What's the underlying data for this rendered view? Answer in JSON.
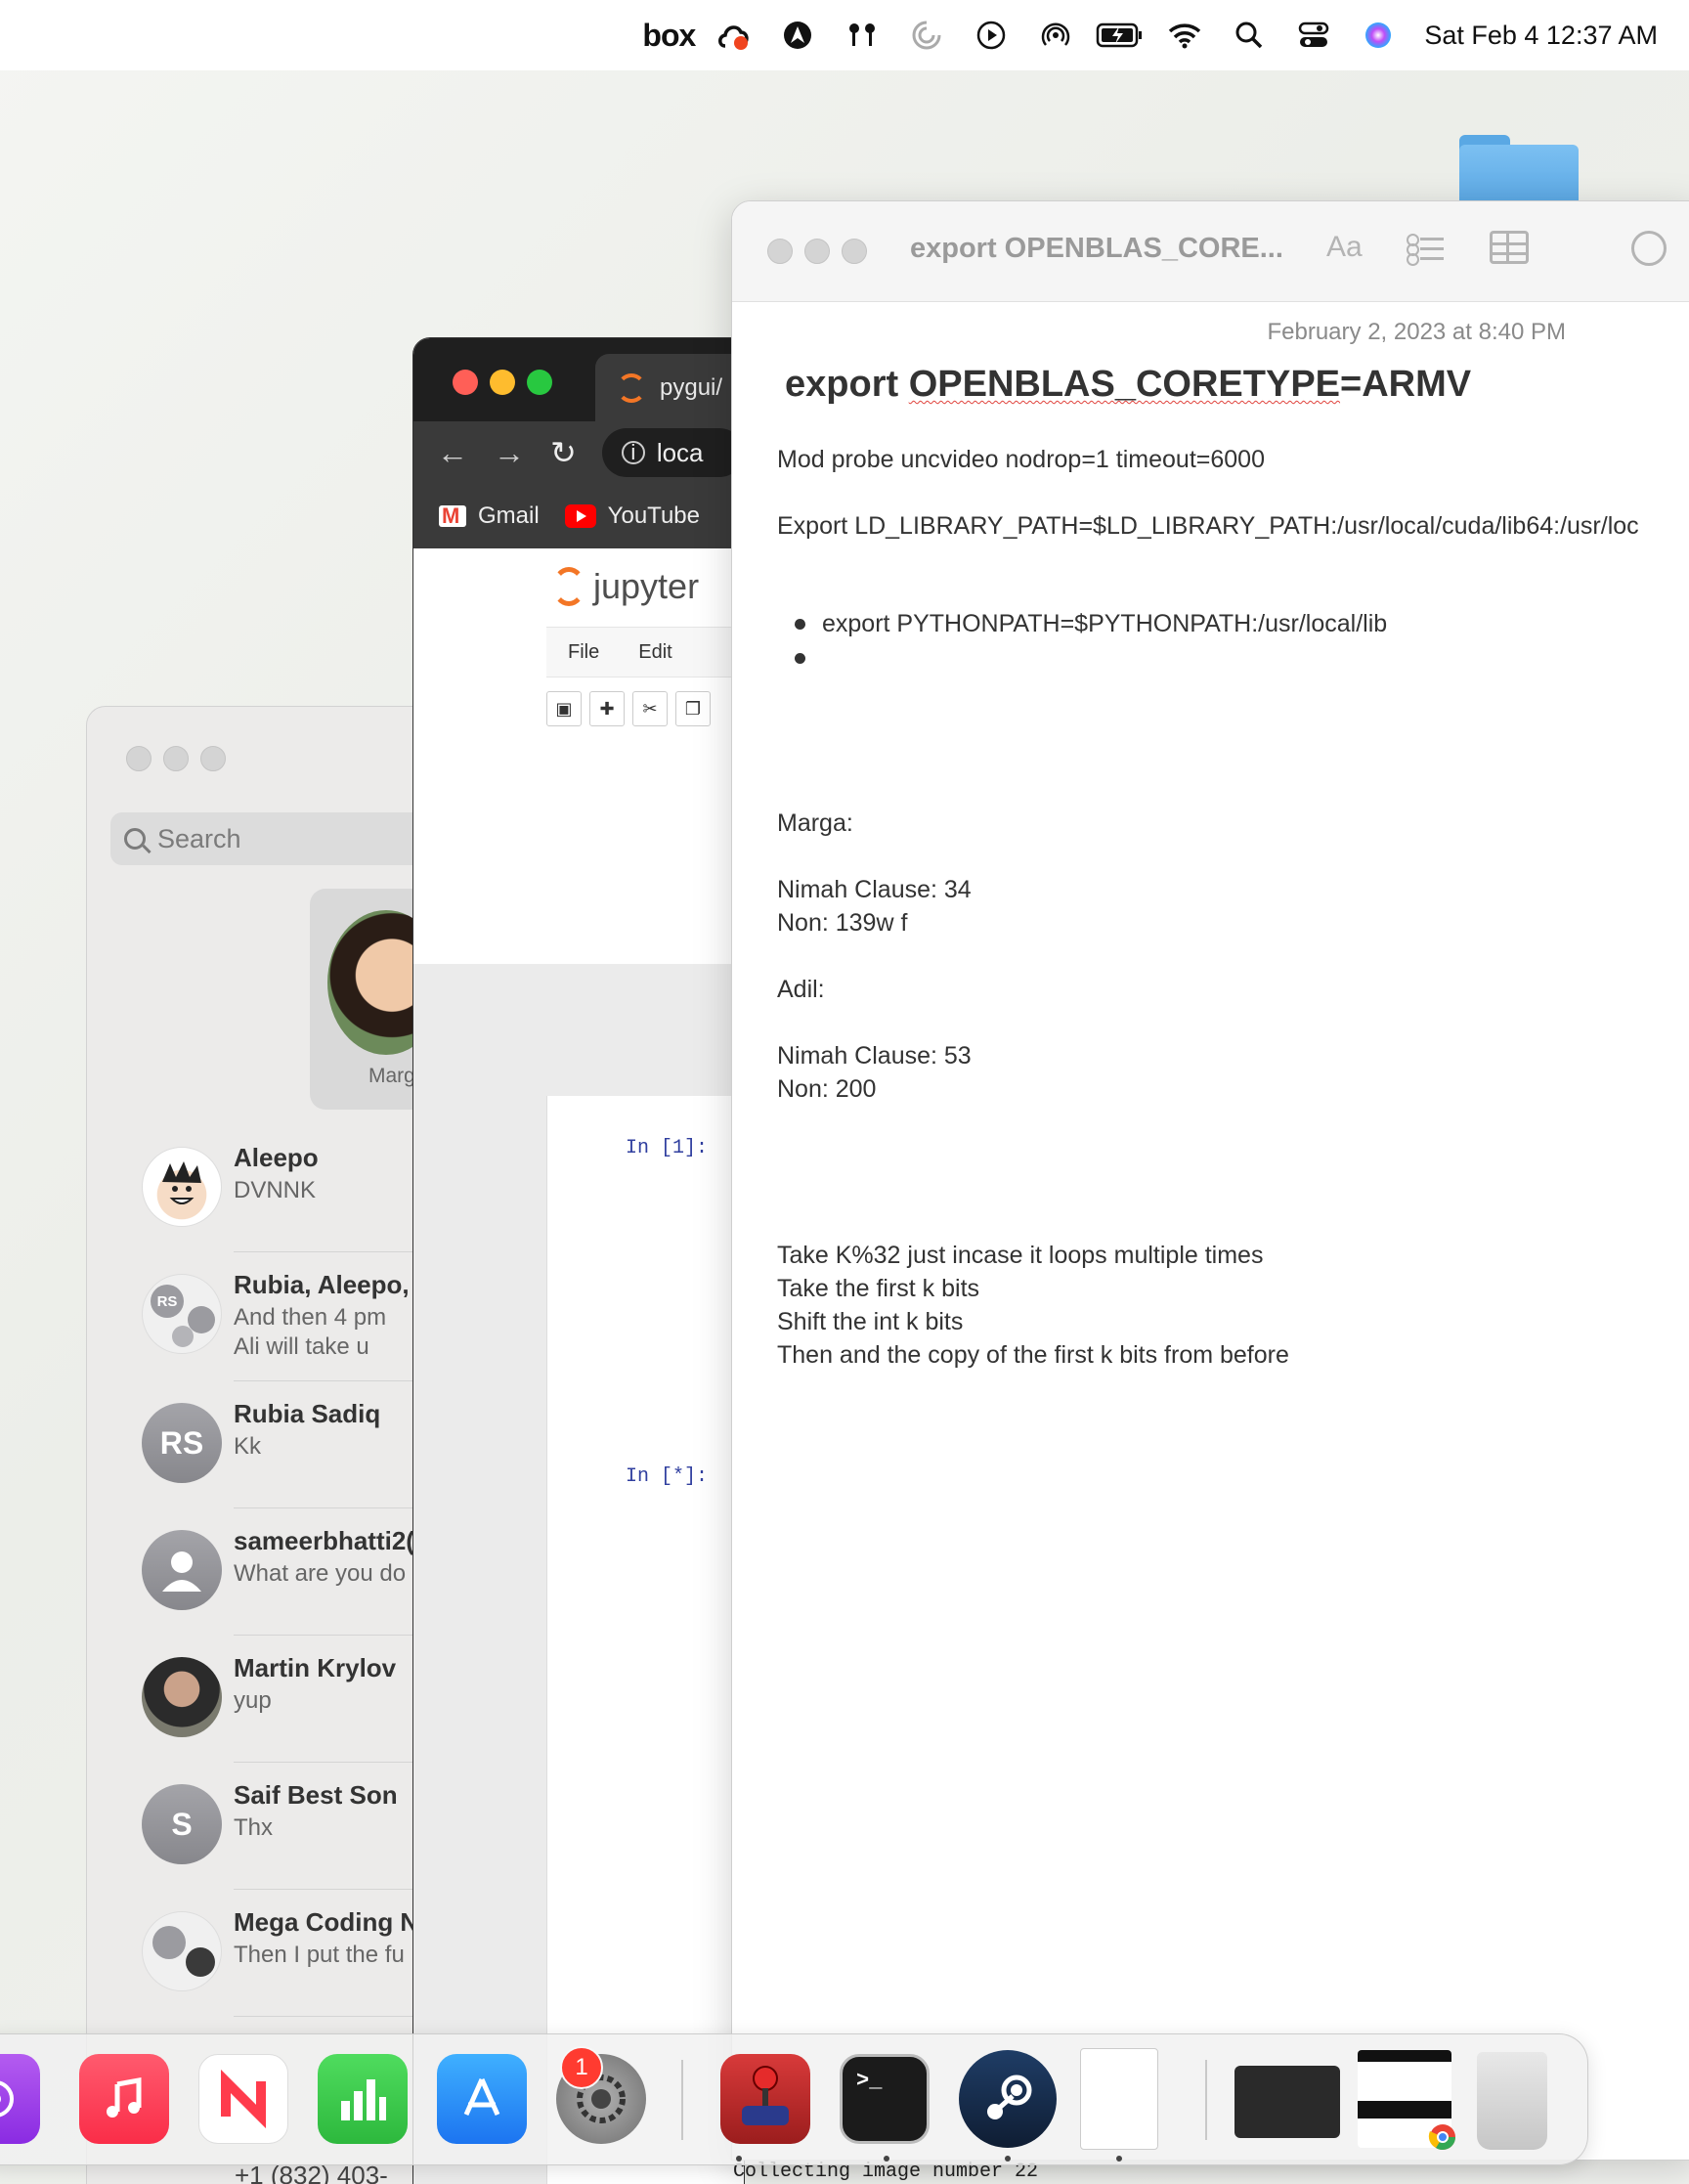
{
  "menubar": {
    "box_label": "box",
    "clock": "Sat Feb 4  12:37 AM",
    "icons": [
      "box-icon",
      "creative-cloud-icon",
      "avast-icon",
      "airpods-icon",
      "loading-icon",
      "play-icon",
      "airdrop-icon",
      "battery-icon",
      "wifi-icon",
      "spotlight-icon",
      "control-center-icon",
      "siri-icon"
    ]
  },
  "messages": {
    "search_placeholder": "Search",
    "pinned_name": "Marg",
    "conversations": [
      {
        "name": "Aleepo",
        "preview": "DVNNK",
        "initials": ""
      },
      {
        "name": "Rubia, Aleepo,",
        "preview": "And then 4 pm",
        "preview2": "Ali will take u",
        "initials": "RS"
      },
      {
        "name": "Rubia Sadiq",
        "preview": "Kk",
        "initials": "RS"
      },
      {
        "name": "sameerbhatti2(",
        "preview": "What are you do",
        "initials": ""
      },
      {
        "name": "Martin Krylov",
        "preview": "yup",
        "initials": ""
      },
      {
        "name": "Saif Best Son",
        "preview": "Thx",
        "initials": "S"
      },
      {
        "name": "Mega Coding N",
        "preview": "Then I put the fu",
        "initials": ""
      }
    ],
    "bottom_text": "+1 (832) 403-"
  },
  "browser": {
    "tab_title": "pygui/",
    "url": "loca",
    "bookmarks": [
      "Gmail",
      "YouTube"
    ],
    "jupyter_title": "jupyter",
    "menu": [
      "File",
      "Edit"
    ],
    "cells": [
      "In [1]:",
      "In [*]:"
    ],
    "status_text": "Collecting image number 22"
  },
  "notes": {
    "window_title": "export OPENBLAS_CORE...",
    "format_label": "Aa",
    "date": "February 2, 2023 at 8:40 PM",
    "heading": "export OPENBLAS_CORETYPE=ARMV",
    "line1": "Mod probe uncvideo nodrop=1 timeout=6000",
    "line2": "Export LD_LIBRARY_PATH=$LD_LIBRARY_PATH:/usr/local/cuda/lib64:/usr/loc",
    "bullet1": "export PYTHONPATH=$PYTHONPATH:/usr/local/lib",
    "marga_label": "Marga:",
    "marga_clause": "Nimah Clause: 34",
    "marga_non": "Non: 139w f",
    "adil_label": "Adil:",
    "adil_clause": "Nimah Clause: 53",
    "adil_non": "Non: 200",
    "k1": "Take K%32 just incase it loops multiple times",
    "k2": "Take the first k bits",
    "k3": "Shift the int k bits",
    "k4": "Then and the copy of the first k bits from before"
  },
  "dock": {
    "apps": [
      "podcasts-icon",
      "music-icon",
      "news-icon",
      "numbers-icon",
      "app-store-icon",
      "system-settings-icon",
      "joystick-app-icon",
      "terminal-icon",
      "steam-icon",
      "blank-document-icon",
      "terminal-window-thumbnail",
      "chrome-window-thumbnail",
      "trash-icon"
    ],
    "settings_badge": "1",
    "colors": {
      "music": "#fa2d48",
      "news": "#ff3b4c",
      "numbers": "#37c848",
      "appstore": "#1c8cf5",
      "steam": "#1b2c44"
    }
  }
}
